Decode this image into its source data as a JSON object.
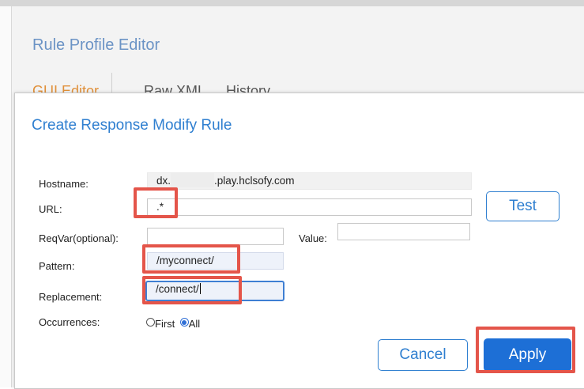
{
  "editor": {
    "title": "Rule Profile Editor",
    "tabs": [
      {
        "label": "GUI Editor",
        "active": true
      },
      {
        "label": "Raw XML",
        "active": false
      },
      {
        "label": "History",
        "active": false
      }
    ]
  },
  "dialog": {
    "title": "Create Response Modify Rule",
    "fields": {
      "hostname": {
        "label": "Hostname:",
        "value_prefix": "dx.",
        "value_suffix": ".play.hclsofy.com"
      },
      "url": {
        "label": "URL:",
        "value": ".*"
      },
      "reqvar": {
        "label": "ReqVar(optional):",
        "value": ""
      },
      "value": {
        "label": "Value:",
        "value": ""
      },
      "pattern": {
        "label": "Pattern:",
        "value": "/myconnect/"
      },
      "replacement": {
        "label": "Replacement:",
        "value": "/connect/"
      },
      "occurrences": {
        "label": "Occurrences:",
        "options": [
          "First",
          "All"
        ],
        "selected": "All"
      }
    },
    "buttons": {
      "test": "Test",
      "cancel": "Cancel",
      "apply": "Apply"
    }
  },
  "colors": {
    "accent": "#2f7fd0",
    "apply_bg": "#1d6fd6",
    "callout": "#e4554a",
    "active_tab": "#e0903a"
  }
}
